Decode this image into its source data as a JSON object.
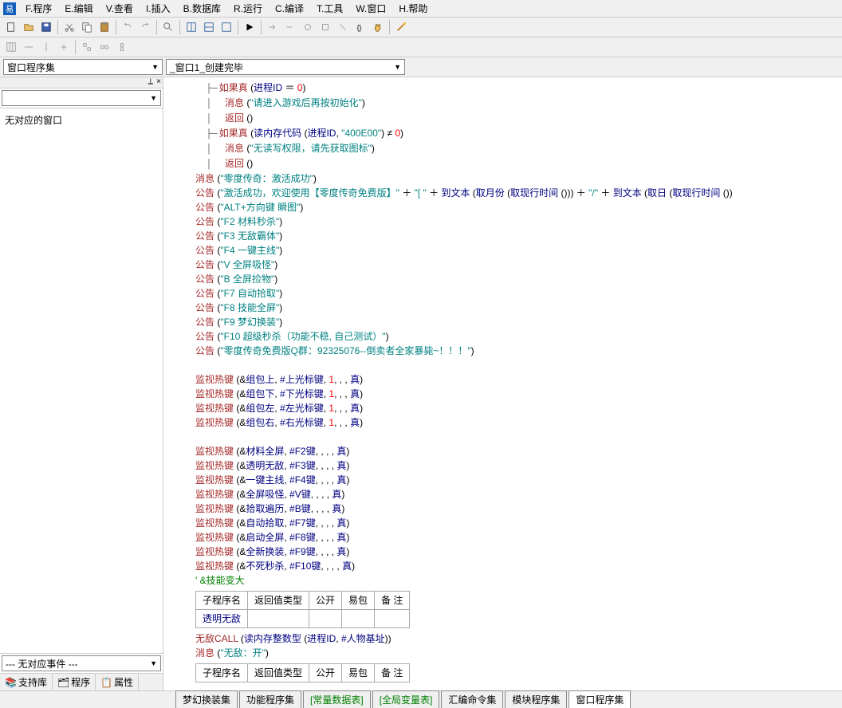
{
  "menu": {
    "items": [
      "F.程序",
      "E.编辑",
      "V.查看",
      "I.插入",
      "B.数据库",
      "R.运行",
      "C.编译",
      "T.工具",
      "W.窗口",
      "H.帮助"
    ]
  },
  "combo": {
    "left": "窗口程序集",
    "right": "_窗口1_创建完毕"
  },
  "left_panel": {
    "tree_text": "无对应的窗口",
    "event_text": "--- 无对应事件 ---",
    "tabs": [
      "支持库",
      "程序",
      "属性"
    ]
  },
  "code": {
    "lines": [
      {
        "t": "if",
        "p": "如果真",
        "r": "(进程ID ＝ 0)"
      },
      {
        "t": "msg",
        "p": "消息",
        "s": "\"请进入游戏后再按初始化\""
      },
      {
        "t": "ret",
        "p": "返回",
        "r": "()"
      },
      {
        "t": "if",
        "p": "如果真",
        "r": "(读内存代码 (进程ID, \"400E00\") ≠ 0)"
      },
      {
        "t": "msg",
        "p": "消息",
        "s": "\"无读写权限，请先获取图标\""
      },
      {
        "t": "ret",
        "p": "返回",
        "r": "()"
      },
      {
        "t": "msg0",
        "p": "消息",
        "s": "\"零度传奇：激活成功\""
      },
      {
        "t": "ann_long",
        "p": "公告",
        "s": "\"激活成功，欢迎使用【零度传奇免费版】\" ＋ \"[ \" ＋ 到文本 (取月份 (取现行时间 ())) ＋ \"/\" ＋ 到文本 (取日 (取现行时间 ())"
      },
      {
        "t": "ann",
        "p": "公告",
        "s": "\"ALT+方向键 瞬图\""
      },
      {
        "t": "ann",
        "p": "公告",
        "s": "\"F2 材料秒杀\""
      },
      {
        "t": "ann",
        "p": "公告",
        "s": "\"F3 无敌霸体\""
      },
      {
        "t": "ann",
        "p": "公告",
        "s": "\"F4 一键主线\""
      },
      {
        "t": "ann",
        "p": "公告",
        "s": "\"V  全屏吸怪\""
      },
      {
        "t": "ann",
        "p": "公告",
        "s": "\"B  全屏捡物\""
      },
      {
        "t": "ann",
        "p": "公告",
        "s": "\"F7 自动拾取\""
      },
      {
        "t": "ann",
        "p": "公告",
        "s": "\"F8 技能全屏\""
      },
      {
        "t": "ann",
        "p": "公告",
        "s": "\"F9 梦幻换装\""
      },
      {
        "t": "ann",
        "p": "公告",
        "s": "\"F10 超级秒杀（功能不稳, 自己测试）\""
      },
      {
        "t": "ann",
        "p": "公告",
        "s": "\"零度传奇免费版Q群：92325076--倒卖者全家暴毙~！！！\""
      },
      {
        "t": "blank"
      },
      {
        "t": "hk",
        "p": "监视热键",
        "r": "(&组包上, #上光标键, 1, , , 真)"
      },
      {
        "t": "hk",
        "p": "监视热键",
        "r": "(&组包下, #下光标键, 1, , , 真)"
      },
      {
        "t": "hk",
        "p": "监视热键",
        "r": "(&组包左, #左光标键, 1, , , 真)"
      },
      {
        "t": "hk",
        "p": "监视热键",
        "r": "(&组包右, #右光标键, 1, , , 真)"
      },
      {
        "t": "blank"
      },
      {
        "t": "hk",
        "p": "监视热键",
        "r": "(&材料全屏, #F2键, , , , 真)"
      },
      {
        "t": "hk",
        "p": "监视热键",
        "r": "(&透明无敌, #F3键, , , , 真)"
      },
      {
        "t": "hk",
        "p": "监视热键",
        "r": "(&一键主线, #F4键, , , , 真)"
      },
      {
        "t": "hk",
        "p": "监视热键",
        "r": "(&全屏吸怪, #V键, , , , 真)"
      },
      {
        "t": "hk",
        "p": "监视热键",
        "r": "(&拾取遍历, #B键, , , , 真)"
      },
      {
        "t": "hk",
        "p": "监视热键",
        "r": "(&自动拾取, #F7键, , , , 真)"
      },
      {
        "t": "hk",
        "p": "监视热键",
        "r": "(&启动全屏, #F8键, , , , 真)"
      },
      {
        "t": "hk",
        "p": "监视热键",
        "r": "(&全新换装, #F9键, , , , 真)"
      },
      {
        "t": "hk",
        "p": "监视热键",
        "r": "(&不死秒杀, #F10键, , , , 真)"
      },
      {
        "t": "cmt",
        "r": "' &技能变大"
      }
    ],
    "sub1": {
      "headers": [
        "子程序名",
        "返回值类型",
        "公开",
        "易包",
        "备 注"
      ],
      "name": "透明无敌"
    },
    "call1": {
      "p": "无敌CALL",
      "r": "(读内存整数型 (进程ID, #人物基址))"
    },
    "msg_open": {
      "p": "消息",
      "s": "\"无敌：开\""
    },
    "sub2": {
      "headers": [
        "子程序名",
        "返回值类型",
        "公开",
        "易包",
        "备 注"
      ]
    }
  },
  "bottom_tabs": [
    "梦幻换装集",
    "功能程序集",
    "[常量数据表]",
    "[全局变量表]",
    "汇编命令集",
    "模块程序集",
    "窗口程序集"
  ]
}
